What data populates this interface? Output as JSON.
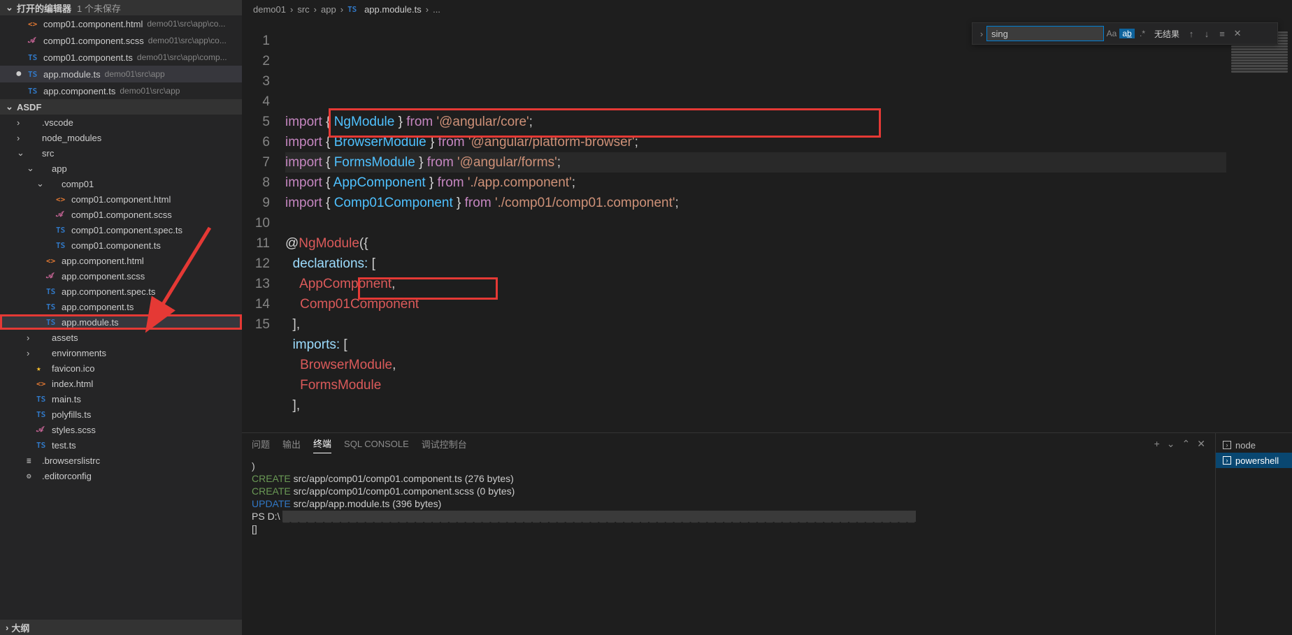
{
  "sidebar": {
    "open_editors": {
      "title": "打开的编辑器",
      "info": "1 个未保存",
      "items": [
        {
          "icon": "<>",
          "iconClass": "icon-html",
          "name": "comp01.component.html",
          "path": "demo01\\src\\app\\co...",
          "modified": false
        },
        {
          "icon": "𝒜",
          "iconClass": "icon-scss",
          "name": "comp01.component.scss",
          "path": "demo01\\src\\app\\co...",
          "modified": false
        },
        {
          "icon": "TS",
          "iconClass": "icon-ts",
          "name": "comp01.component.ts",
          "path": "demo01\\src\\app\\comp...",
          "modified": false
        },
        {
          "icon": "TS",
          "iconClass": "icon-ts",
          "name": "app.module.ts",
          "path": "demo01\\src\\app",
          "modified": true,
          "active": true
        },
        {
          "icon": "TS",
          "iconClass": "icon-ts",
          "name": "app.component.ts",
          "path": "demo01\\src\\app",
          "modified": false
        }
      ]
    },
    "explorer": {
      "title": "ASDF",
      "tree": [
        {
          "indent": 1,
          "chev": "›",
          "icon": "",
          "iconClass": "icon-folder",
          "name": ".vscode"
        },
        {
          "indent": 1,
          "chev": "›",
          "icon": "",
          "iconClass": "icon-folder",
          "name": "node_modules"
        },
        {
          "indent": 1,
          "chev": "⌄",
          "icon": "",
          "iconClass": "icon-folder",
          "name": "src"
        },
        {
          "indent": 2,
          "chev": "⌄",
          "icon": "",
          "iconClass": "icon-folder",
          "name": "app"
        },
        {
          "indent": 3,
          "chev": "⌄",
          "icon": "",
          "iconClass": "icon-folder",
          "name": "comp01"
        },
        {
          "indent": 4,
          "chev": "",
          "icon": "<>",
          "iconClass": "icon-html",
          "name": "comp01.component.html"
        },
        {
          "indent": 4,
          "chev": "",
          "icon": "𝒜",
          "iconClass": "icon-scss",
          "name": "comp01.component.scss"
        },
        {
          "indent": 4,
          "chev": "",
          "icon": "TS",
          "iconClass": "icon-ts",
          "name": "comp01.component.spec.ts"
        },
        {
          "indent": 4,
          "chev": "",
          "icon": "TS",
          "iconClass": "icon-ts",
          "name": "comp01.component.ts"
        },
        {
          "indent": 3,
          "chev": "",
          "icon": "<>",
          "iconClass": "icon-html",
          "name": "app.component.html"
        },
        {
          "indent": 3,
          "chev": "",
          "icon": "𝒜",
          "iconClass": "icon-scss",
          "name": "app.component.scss"
        },
        {
          "indent": 3,
          "chev": "",
          "icon": "TS",
          "iconClass": "icon-ts",
          "name": "app.component.spec.ts"
        },
        {
          "indent": 3,
          "chev": "",
          "icon": "TS",
          "iconClass": "icon-ts",
          "name": "app.component.ts"
        },
        {
          "indent": 3,
          "chev": "",
          "icon": "TS",
          "iconClass": "icon-ts",
          "name": "app.module.ts",
          "selected": true
        },
        {
          "indent": 2,
          "chev": "›",
          "icon": "",
          "iconClass": "icon-folder",
          "name": "assets"
        },
        {
          "indent": 2,
          "chev": "›",
          "icon": "",
          "iconClass": "icon-folder",
          "name": "environments"
        },
        {
          "indent": 2,
          "chev": "",
          "icon": "★",
          "iconClass": "icon-star",
          "name": "favicon.ico"
        },
        {
          "indent": 2,
          "chev": "",
          "icon": "<>",
          "iconClass": "icon-html",
          "name": "index.html"
        },
        {
          "indent": 2,
          "chev": "",
          "icon": "TS",
          "iconClass": "icon-ts",
          "name": "main.ts"
        },
        {
          "indent": 2,
          "chev": "",
          "icon": "TS",
          "iconClass": "icon-ts",
          "name": "polyfills.ts"
        },
        {
          "indent": 2,
          "chev": "",
          "icon": "𝒜",
          "iconClass": "icon-scss",
          "name": "styles.scss"
        },
        {
          "indent": 2,
          "chev": "",
          "icon": "TS",
          "iconClass": "icon-ts",
          "name": "test.ts"
        },
        {
          "indent": 1,
          "chev": "",
          "icon": "≡",
          "iconClass": "icon-gear",
          "name": ".browserslistrc"
        },
        {
          "indent": 1,
          "chev": "",
          "icon": "⚙",
          "iconClass": "icon-gear",
          "name": ".editorconfig"
        }
      ]
    },
    "outline": {
      "title": "大纲"
    }
  },
  "breadcrumbs": {
    "segments": [
      "demo01",
      "src",
      "app"
    ],
    "file_icon": "TS",
    "file": "app.module.ts",
    "more": "..."
  },
  "find": {
    "value": "sing",
    "opt_case": "Aa",
    "opt_word": "ab̲",
    "opt_regex": ".*",
    "results": "无结果"
  },
  "code_lines": [
    [
      "import",
      " { ",
      "NgModule",
      " } ",
      "from",
      " ",
      "'@angular/core'",
      ";"
    ],
    [
      "import",
      " { ",
      "BrowserModule",
      " } ",
      "from",
      " ",
      "'@angular/platform-browser'",
      ";"
    ],
    [
      "import",
      " { ",
      "FormsModule",
      " } ",
      "from",
      " ",
      "'@angular/forms'",
      ";"
    ],
    [
      "import",
      " { ",
      "AppComponent",
      " } ",
      "from",
      " ",
      "'./app.component'",
      ";"
    ],
    [
      "import",
      " { ",
      "Comp01Component",
      " } ",
      "from",
      " ",
      "'./comp01/comp01.component'",
      ";"
    ],
    [
      ""
    ],
    [
      "@",
      "NgModule",
      "({"
    ],
    [
      "  ",
      "declarations:",
      " ["
    ],
    [
      "    ",
      "AppComponent",
      ","
    ],
    [
      "    ",
      "Comp01Component"
    ],
    [
      "  ],"
    ],
    [
      "  ",
      "imports:",
      " ["
    ],
    [
      "    ",
      "BrowserModule",
      ","
    ],
    [
      "    ",
      "FormsModule"
    ],
    [
      "  ],"
    ]
  ],
  "panel": {
    "tabs": [
      "问题",
      "输出",
      "终端",
      "SQL CONSOLE",
      "调试控制台"
    ],
    "active_tab": 2,
    "terminal": {
      "lines": [
        {
          "pre": ")",
          "rest": ""
        },
        {
          "pre": "CREATE",
          "rest": " src/app/comp01/comp01.component.ts (276 bytes)",
          "cls": "create"
        },
        {
          "pre": "CREATE",
          "rest": " src/app/comp01/comp01.component.scss (0 bytes)",
          "cls": "create"
        },
        {
          "pre": "UPDATE",
          "rest": " src/app/app.module.ts (396 bytes)",
          "cls": "update"
        },
        {
          "pre": "PS D:\\",
          "rest": "████████████████████████████████████████████████████████████████████████████",
          "cls": "blur"
        },
        {
          "pre": "[]",
          "rest": ""
        }
      ]
    },
    "shells": [
      {
        "icon": ">",
        "label": "node"
      },
      {
        "icon": ">",
        "label": "powershell",
        "active": true
      }
    ]
  }
}
